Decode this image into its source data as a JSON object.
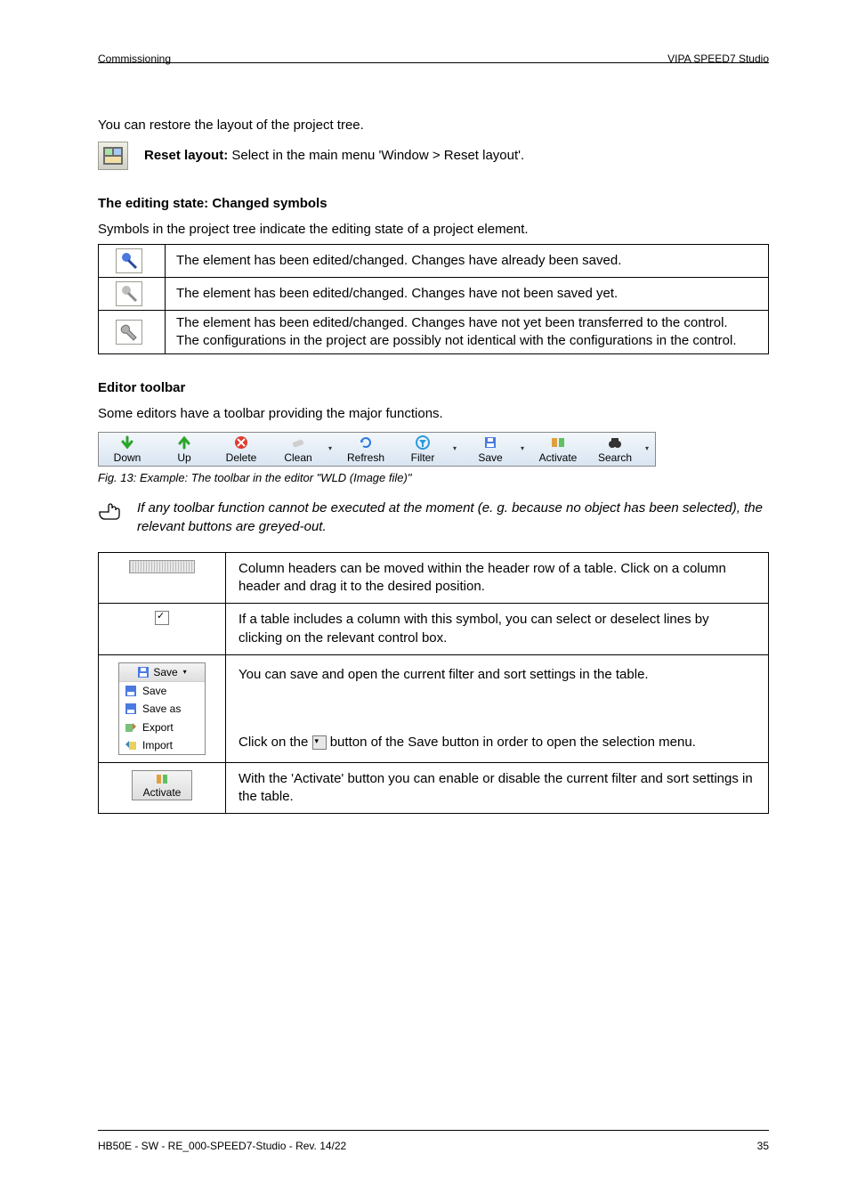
{
  "header": {
    "left": "Commissioning",
    "right": "VIPA SPEED7 Studio"
  },
  "footer": {
    "left": "HB50E - SW - RE_000-SPEED7-Studio - Rev. 14/22",
    "right": "35"
  },
  "intro": {
    "line1": "You can restore the layout of the project tree.",
    "action_label": "Reset layout:",
    "action_desc": "Select in the main menu 'Window > Reset layout'."
  },
  "section1": {
    "heading": "The editing state: Changed symbols",
    "lead": "Symbols in the project tree indicate the editing state of a project element.",
    "row1": "The element has been edited/changed. Changes have already been saved.",
    "row2": "The element has been edited/changed. Changes have not been saved yet.",
    "row3": "The element has been edited/changed. Changes have not yet been transferred to the control.\nThe configurations in the project are possibly not identical with the configurations in the control."
  },
  "section2": {
    "heading": "Editor toolbar",
    "lead": "Some editors have a toolbar providing the major functions.",
    "toolbar": {
      "down": "Down",
      "up": "Up",
      "delete": "Delete",
      "clean": "Clean",
      "refresh": "Refresh",
      "filter": "Filter",
      "save": "Save",
      "activate": "Activate",
      "search": "Search"
    },
    "fig": "Fig. 13: Example: The toolbar in the editor \"WLD (Image file)\"",
    "note": "If any toolbar function cannot be executed at the moment (e. g. because no object has been selected), the relevant buttons are greyed-out."
  },
  "desc_table": {
    "row_header": "Column headers can be moved within the header row of a table. Click on a column header and drag it to the desired position.",
    "row_check": "If a table includes a column with this symbol, you can select or deselect lines by clicking on the relevant control box.",
    "row_save": {
      "line1": "You can save and open the current filter and sort settings in the table.",
      "line2": "Click on the ",
      "line2_after": " button of the Save button in order to open the selection menu.",
      "menu": {
        "save": "Save",
        "saveas": "Save as",
        "export": "Export",
        "import": "Import"
      }
    },
    "row_activate": "With the 'Activate' button you can enable or disable the current filter and sort settings in the table."
  }
}
